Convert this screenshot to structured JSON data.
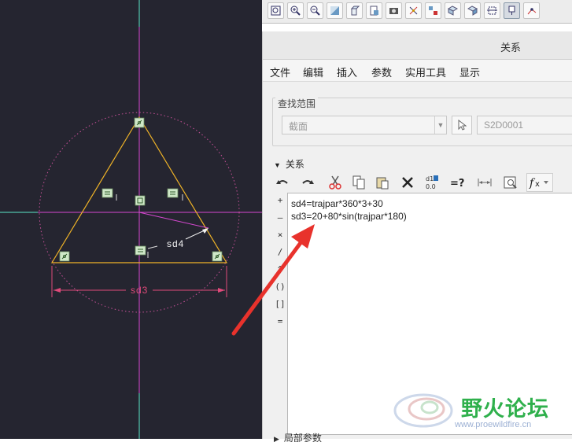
{
  "sketch": {
    "dimension_sd4": "sd4",
    "dimension_sd3": "sd3",
    "colors": {
      "background": "#252530",
      "triangle": "#f0b428",
      "centerline": "#d548d0",
      "axis": "#5ae8c8",
      "construction_circle": "#c9519a",
      "dimension": "#e04a7a"
    }
  },
  "toolbar": {
    "icons": [
      "refit-icon",
      "zoom-in-icon",
      "zoom-out-icon",
      "repaint-icon",
      "view-orient-icon",
      "saved-views-icon",
      "display-style-icon",
      "datum-display-icon",
      "spin-center-icon",
      "perspective-icon",
      "annotation-display-icon",
      "dimension-display-icon",
      "constraint-display-icon",
      "vertex-display-icon"
    ]
  },
  "dialog": {
    "title": "关系",
    "menu": [
      "文件",
      "编辑",
      "插入",
      "参数",
      "实用工具",
      "显示"
    ],
    "scope": {
      "legend": "查找范围",
      "type_value": "截面",
      "name_value": "S2D0001"
    },
    "relations_section_label": "关系",
    "relations_toolbar": [
      "undo-icon",
      "redo-icon",
      "cut-icon",
      "copy-icon",
      "paste-icon",
      "delete-icon",
      "toggle-values-icon",
      "verify-icon",
      "sort-icon",
      "evaluate-icon",
      "function-icon"
    ],
    "operators": [
      "+",
      "–",
      "×",
      "/",
      "^",
      "()",
      "[]",
      "="
    ],
    "relations": [
      "sd4=trajpar*360*3+30",
      "sd3=20+80*sin(trajpar*180)"
    ],
    "local_params_label": "局部参数"
  },
  "watermark": {
    "title": "野火论坛",
    "url": "www.proewildfire.cn"
  }
}
